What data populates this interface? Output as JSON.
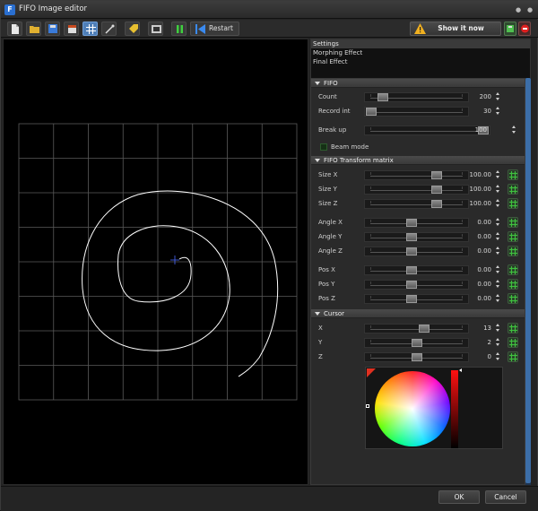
{
  "window": {
    "title": "FIFO Image editor",
    "icon": "fifo-app-icon"
  },
  "toolbar": {
    "icons": [
      "new-file-icon",
      "open-folder-icon",
      "save-icon",
      "export-icon",
      "grid-icon",
      "pen-tool-icon",
      "tag-icon",
      "film-icon",
      "pause-icon",
      "restart-icon"
    ],
    "restart_label": "Restart",
    "show_label": "Show it now"
  },
  "settings": {
    "header": "Settings",
    "items": [
      "Morphing Effect",
      "Final Effect"
    ]
  },
  "fifo": {
    "header": "FIFO",
    "count": {
      "label": "Count",
      "value": "200",
      "level": 0.13
    },
    "record_int": {
      "label": "Record int",
      "value": "30",
      "level": 0.0
    },
    "break_up": {
      "label": "Break up",
      "value": "100",
      "level": 1.0
    },
    "beam_mode": "Beam mode"
  },
  "transform": {
    "header": "FIFO Transform matrix",
    "rows": [
      {
        "label": "Size X",
        "value": "100.00",
        "level": 0.72
      },
      {
        "label": "Size Y",
        "value": "100.00",
        "level": 0.72
      },
      {
        "label": "Size Z",
        "value": "100.00",
        "level": 0.72
      },
      {
        "label": "Angle X",
        "value": "0.00",
        "level": 0.45
      },
      {
        "label": "Angle Y",
        "value": "0.00",
        "level": 0.45
      },
      {
        "label": "Angle Z",
        "value": "0.00",
        "level": 0.45
      },
      {
        "label": "Pos X",
        "value": "0.00",
        "level": 0.45
      },
      {
        "label": "Pos Y",
        "value": "0.00",
        "level": 0.45
      },
      {
        "label": "Pos Z",
        "value": "0.00",
        "level": 0.45
      }
    ]
  },
  "cursor": {
    "header": "Cursor",
    "rows": [
      {
        "label": "X",
        "value": "13",
        "level": 0.58
      },
      {
        "label": "Y",
        "value": "2",
        "level": 0.5
      },
      {
        "label": "Z",
        "value": "0",
        "level": 0.5
      }
    ]
  },
  "footer": {
    "ok": "OK",
    "cancel": "Cancel"
  },
  "colors": {
    "accent_blue": "#3c6ea8",
    "canvas_bg": "#000000",
    "grid": "#5a5a5a",
    "stroke": "#ffffff",
    "lock_green": "#3fbf3f"
  }
}
